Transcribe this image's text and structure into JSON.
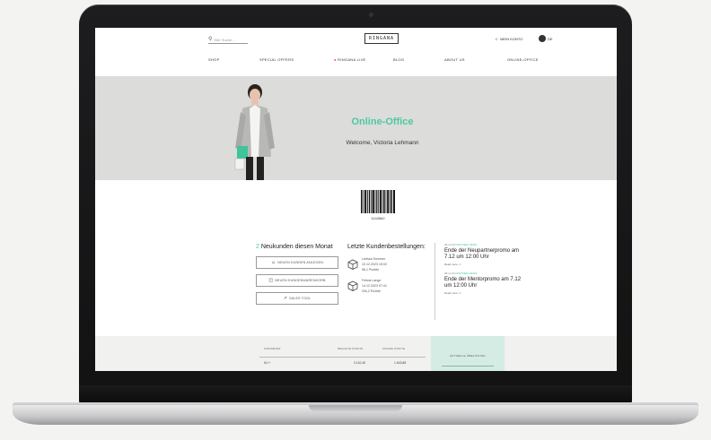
{
  "header": {
    "search_placeholder": "Hier Suche ...",
    "logo_text": "RINGANA",
    "account_label": "MEIN KONTO",
    "lang_label": "DE"
  },
  "nav": [
    {
      "label": "SHOP"
    },
    {
      "label": "SPECIAL OFFERS"
    },
    {
      "label": "RINGANA LIVE"
    },
    {
      "label": "BLOG"
    },
    {
      "label": "ABOUT US"
    },
    {
      "label": "ONLINE-OFFICE"
    }
  ],
  "hero": {
    "title": "Online-Office",
    "subtitle": "Welcome, Victoria Lehmann"
  },
  "barcode": {
    "number": "1142662"
  },
  "new_customers": {
    "count": "2",
    "label": "Neukunden diesen Monat",
    "buttons": [
      {
        "label": "NEUEN KUNDEN ANLEGEN",
        "icon": "user-icon"
      },
      {
        "label": "NEUEN KUNDENWARENKORB",
        "icon": "basket-icon"
      },
      {
        "label": "SALES TOOL",
        "icon": "chart-icon"
      }
    ]
  },
  "orders": {
    "title": "Letzte Kundenbestellungen:",
    "items": [
      {
        "name": "Larissa Sommer",
        "date": "10.12.2023 10:02",
        "points": "58,1 Punkte"
      },
      {
        "name": "Felicia Lange",
        "date": "14.12.2023 07:41",
        "points": "20k,2 Punkte"
      }
    ]
  },
  "news": [
    {
      "date": "08.12.20",
      "tag": "PARTNER NEWS",
      "title": "Ende der Neupartnerpromo am 7.12 um 12:00 Uhr",
      "more": "Read more >>"
    },
    {
      "date": "08.12.20",
      "tag": "PARTNER NEWS",
      "title": "Ende der Mentorpromo am 7.12 um 12:00 Uhr",
      "more": "Read more >>"
    }
  ],
  "table": {
    "headers": [
      "PARAMETER",
      "BEZAHLTE PUNKTE",
      "OFFENE PUNKTE"
    ],
    "row": [
      "KU +",
      "3.110,45",
      "1.643,88"
    ],
    "update_label": "AKTUELLE ÜBELSTUNG"
  },
  "colors": {
    "accent": "#4cc9a4",
    "live_dot": "#e23a3a",
    "hero_bg": "#dcdcda"
  }
}
